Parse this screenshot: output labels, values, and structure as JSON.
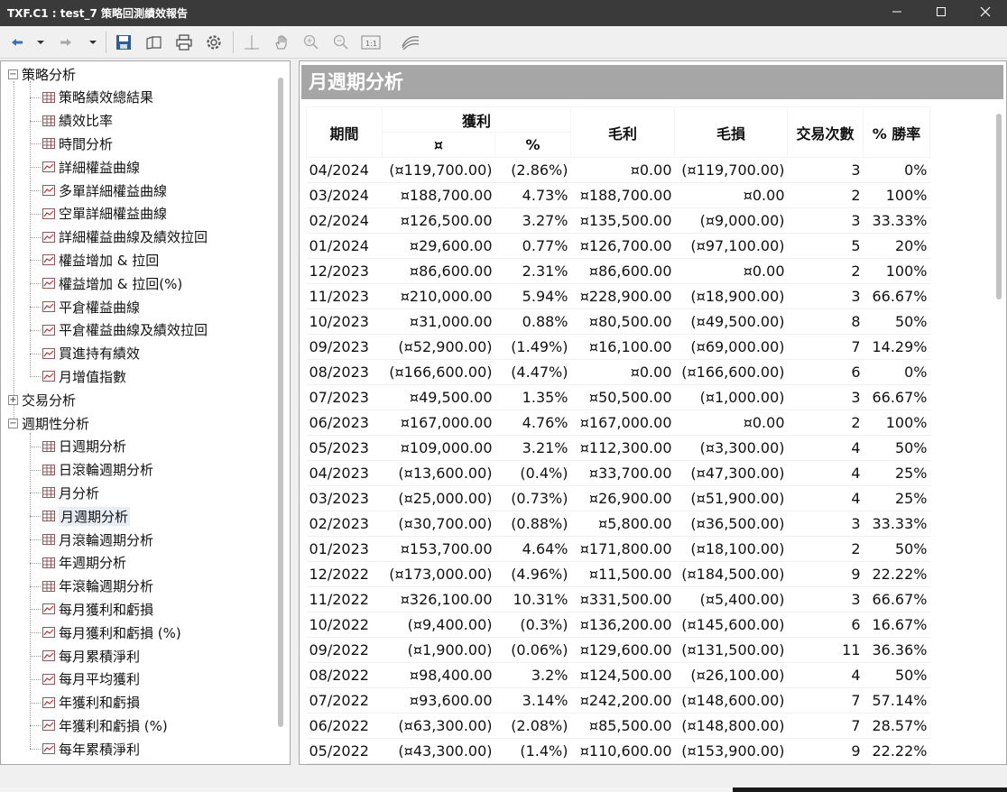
{
  "window": {
    "title": "TXF.C1 : test_7 策略回測績效報告"
  },
  "toolbar": {
    "buttons": [
      "back-icon",
      "dropdown-icon",
      "forward-icon",
      "dropdown-icon",
      "save-icon",
      "open-icon",
      "print-icon",
      "settings-icon",
      "crosshair-icon",
      "hand-icon",
      "zoom-in-icon",
      "zoom-out-icon",
      "zoom-actual-icon",
      "chart-style-icon"
    ]
  },
  "tree": {
    "strategy_group": "策略分析",
    "strategy_items": [
      {
        "label": "策略績效總結果",
        "icon": "table-icon"
      },
      {
        "label": "績效比率",
        "icon": "table-icon"
      },
      {
        "label": "時間分析",
        "icon": "table-icon"
      },
      {
        "label": "詳細權益曲線",
        "icon": "chart-icon"
      },
      {
        "label": "多單詳細權益曲線",
        "icon": "chart-icon"
      },
      {
        "label": "空單詳細權益曲線",
        "icon": "chart-icon"
      },
      {
        "label": "詳細權益曲線及績效拉回",
        "icon": "chart-icon"
      },
      {
        "label": "權益增加 & 拉回",
        "icon": "chart-icon"
      },
      {
        "label": "權益增加 & 拉回(%)",
        "icon": "chart-icon"
      },
      {
        "label": "平倉權益曲線",
        "icon": "chart-icon"
      },
      {
        "label": "平倉權益曲線及績效拉回",
        "icon": "chart-icon"
      },
      {
        "label": "買進持有績效",
        "icon": "chart-icon"
      },
      {
        "label": "月增值指數",
        "icon": "chart-icon"
      }
    ],
    "trade_group": "交易分析",
    "periodic_group": "週期性分析",
    "periodic_items": [
      {
        "label": "日週期分析",
        "icon": "table-icon"
      },
      {
        "label": "日滾輪週期分析",
        "icon": "table-icon"
      },
      {
        "label": "月分析",
        "icon": "table-icon"
      },
      {
        "label": "月週期分析",
        "icon": "table-icon"
      },
      {
        "label": "月滾輪週期分析",
        "icon": "table-icon"
      },
      {
        "label": "年週期分析",
        "icon": "table-icon"
      },
      {
        "label": "年滾輪週期分析",
        "icon": "table-icon"
      },
      {
        "label": "每月獲利和虧損",
        "icon": "chart-icon"
      },
      {
        "label": "每月獲利和虧損 (%)",
        "icon": "chart-icon"
      },
      {
        "label": "每月累積淨利",
        "icon": "chart-icon"
      },
      {
        "label": "每月平均獲利",
        "icon": "chart-icon"
      },
      {
        "label": "年獲利和虧損",
        "icon": "chart-icon"
      },
      {
        "label": "年獲利和虧損 (%)",
        "icon": "chart-icon"
      },
      {
        "label": "每年累積淨利",
        "icon": "chart-icon"
      }
    ],
    "selected_label": "月週期分析"
  },
  "report": {
    "title": "月週期分析",
    "headers": {
      "period": "期間",
      "profit": "獲利",
      "profit_currency": "¤",
      "profit_pct": "%",
      "gross_profit": "毛利",
      "gross_loss": "毛損",
      "trades": "交易次數",
      "win_rate": "% 勝率"
    },
    "rows": [
      [
        "04/2024",
        "(¤119,700.00)",
        "(2.86%)",
        "¤0.00",
        "(¤119,700.00)",
        "3",
        "0%"
      ],
      [
        "03/2024",
        "¤188,700.00",
        "4.73%",
        "¤188,700.00",
        "¤0.00",
        "2",
        "100%"
      ],
      [
        "02/2024",
        "¤126,500.00",
        "3.27%",
        "¤135,500.00",
        "(¤9,000.00)",
        "3",
        "33.33%"
      ],
      [
        "01/2024",
        "¤29,600.00",
        "0.77%",
        "¤126,700.00",
        "(¤97,100.00)",
        "5",
        "20%"
      ],
      [
        "12/2023",
        "¤86,600.00",
        "2.31%",
        "¤86,600.00",
        "¤0.00",
        "2",
        "100%"
      ],
      [
        "11/2023",
        "¤210,000.00",
        "5.94%",
        "¤228,900.00",
        "(¤18,900.00)",
        "3",
        "66.67%"
      ],
      [
        "10/2023",
        "¤31,000.00",
        "0.88%",
        "¤80,500.00",
        "(¤49,500.00)",
        "8",
        "50%"
      ],
      [
        "09/2023",
        "(¤52,900.00)",
        "(1.49%)",
        "¤16,100.00",
        "(¤69,000.00)",
        "7",
        "14.29%"
      ],
      [
        "08/2023",
        "(¤166,600.00)",
        "(4.47%)",
        "¤0.00",
        "(¤166,600.00)",
        "6",
        "0%"
      ],
      [
        "07/2023",
        "¤49,500.00",
        "1.35%",
        "¤50,500.00",
        "(¤1,000.00)",
        "3",
        "66.67%"
      ],
      [
        "06/2023",
        "¤167,000.00",
        "4.76%",
        "¤167,000.00",
        "¤0.00",
        "2",
        "100%"
      ],
      [
        "05/2023",
        "¤109,000.00",
        "3.21%",
        "¤112,300.00",
        "(¤3,300.00)",
        "4",
        "50%"
      ],
      [
        "04/2023",
        "(¤13,600.00)",
        "(0.4%)",
        "¤33,700.00",
        "(¤47,300.00)",
        "4",
        "25%"
      ],
      [
        "03/2023",
        "(¤25,000.00)",
        "(0.73%)",
        "¤26,900.00",
        "(¤51,900.00)",
        "4",
        "25%"
      ],
      [
        "02/2023",
        "(¤30,700.00)",
        "(0.88%)",
        "¤5,800.00",
        "(¤36,500.00)",
        "3",
        "33.33%"
      ],
      [
        "01/2023",
        "¤153,700.00",
        "4.64%",
        "¤171,800.00",
        "(¤18,100.00)",
        "2",
        "50%"
      ],
      [
        "12/2022",
        "(¤173,000.00)",
        "(4.96%)",
        "¤11,500.00",
        "(¤184,500.00)",
        "9",
        "22.22%"
      ],
      [
        "11/2022",
        "¤326,100.00",
        "10.31%",
        "¤331,500.00",
        "(¤5,400.00)",
        "3",
        "66.67%"
      ],
      [
        "10/2022",
        "(¤9,400.00)",
        "(0.3%)",
        "¤136,200.00",
        "(¤145,600.00)",
        "6",
        "16.67%"
      ],
      [
        "09/2022",
        "(¤1,900.00)",
        "(0.06%)",
        "¤129,600.00",
        "(¤131,500.00)",
        "11",
        "36.36%"
      ],
      [
        "08/2022",
        "¤98,400.00",
        "3.2%",
        "¤124,500.00",
        "(¤26,100.00)",
        "4",
        "50%"
      ],
      [
        "07/2022",
        "¤93,600.00",
        "3.14%",
        "¤242,200.00",
        "(¤148,600.00)",
        "7",
        "57.14%"
      ],
      [
        "06/2022",
        "(¤63,300.00)",
        "(2.08%)",
        "¤85,500.00",
        "(¤148,800.00)",
        "7",
        "28.57%"
      ],
      [
        "05/2022",
        "(¤43,300.00)",
        "(1.4%)",
        "¤110,600.00",
        "(¤153,900.00)",
        "9",
        "22.22%"
      ]
    ]
  },
  "colors": {
    "negative": "#d81e1e",
    "header_bg": "#a6a6a6",
    "titlebar_bg": "#3a3a3a"
  }
}
